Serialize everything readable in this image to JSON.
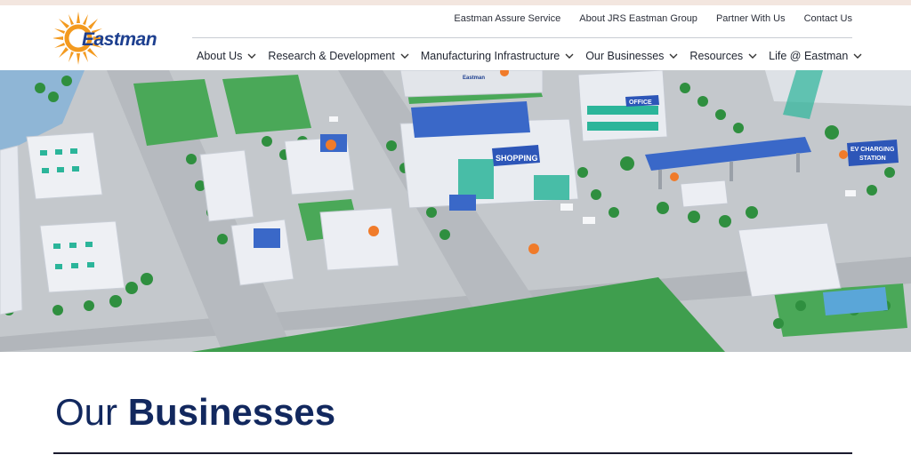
{
  "brand": {
    "name": "Eastman",
    "colors": {
      "navy": "#1d3f8f",
      "sun_orange": "#f39a1f",
      "nav_text": "#1f2430"
    }
  },
  "utility_nav": [
    {
      "label": "Eastman Assure Service"
    },
    {
      "label": "About JRS Eastman Group"
    },
    {
      "label": "Partner With Us"
    },
    {
      "label": "Contact Us"
    }
  ],
  "main_nav": [
    {
      "label": "About Us",
      "icon": "chevron-down-icon"
    },
    {
      "label": "Research & Development",
      "icon": "chevron-down-icon"
    },
    {
      "label": "Manufacturing Infrastructure",
      "icon": "chevron-down-icon"
    },
    {
      "label": "Our Businesses",
      "icon": "chevron-down-icon"
    },
    {
      "label": "Resources",
      "icon": "chevron-down-icon"
    },
    {
      "label": "Life @ Eastman",
      "icon": "chevron-down-icon"
    }
  ],
  "hero": {
    "signs": {
      "shopping": "SHOPPING",
      "office": "OFFICE",
      "ev_line1": "EV CHARGING",
      "ev_line2": "STATION",
      "rooftop": "Eastman"
    },
    "colors": {
      "road": "#b9bdc2",
      "grass": "#3f9e4e",
      "building": "#eef0f4",
      "window": "#2bb59a",
      "solar": "#3a68c8",
      "sign_blue": "#2d56b8",
      "pin": "#f07b2a"
    }
  },
  "section": {
    "title_light": "Our",
    "title_bold": "Businesses"
  }
}
